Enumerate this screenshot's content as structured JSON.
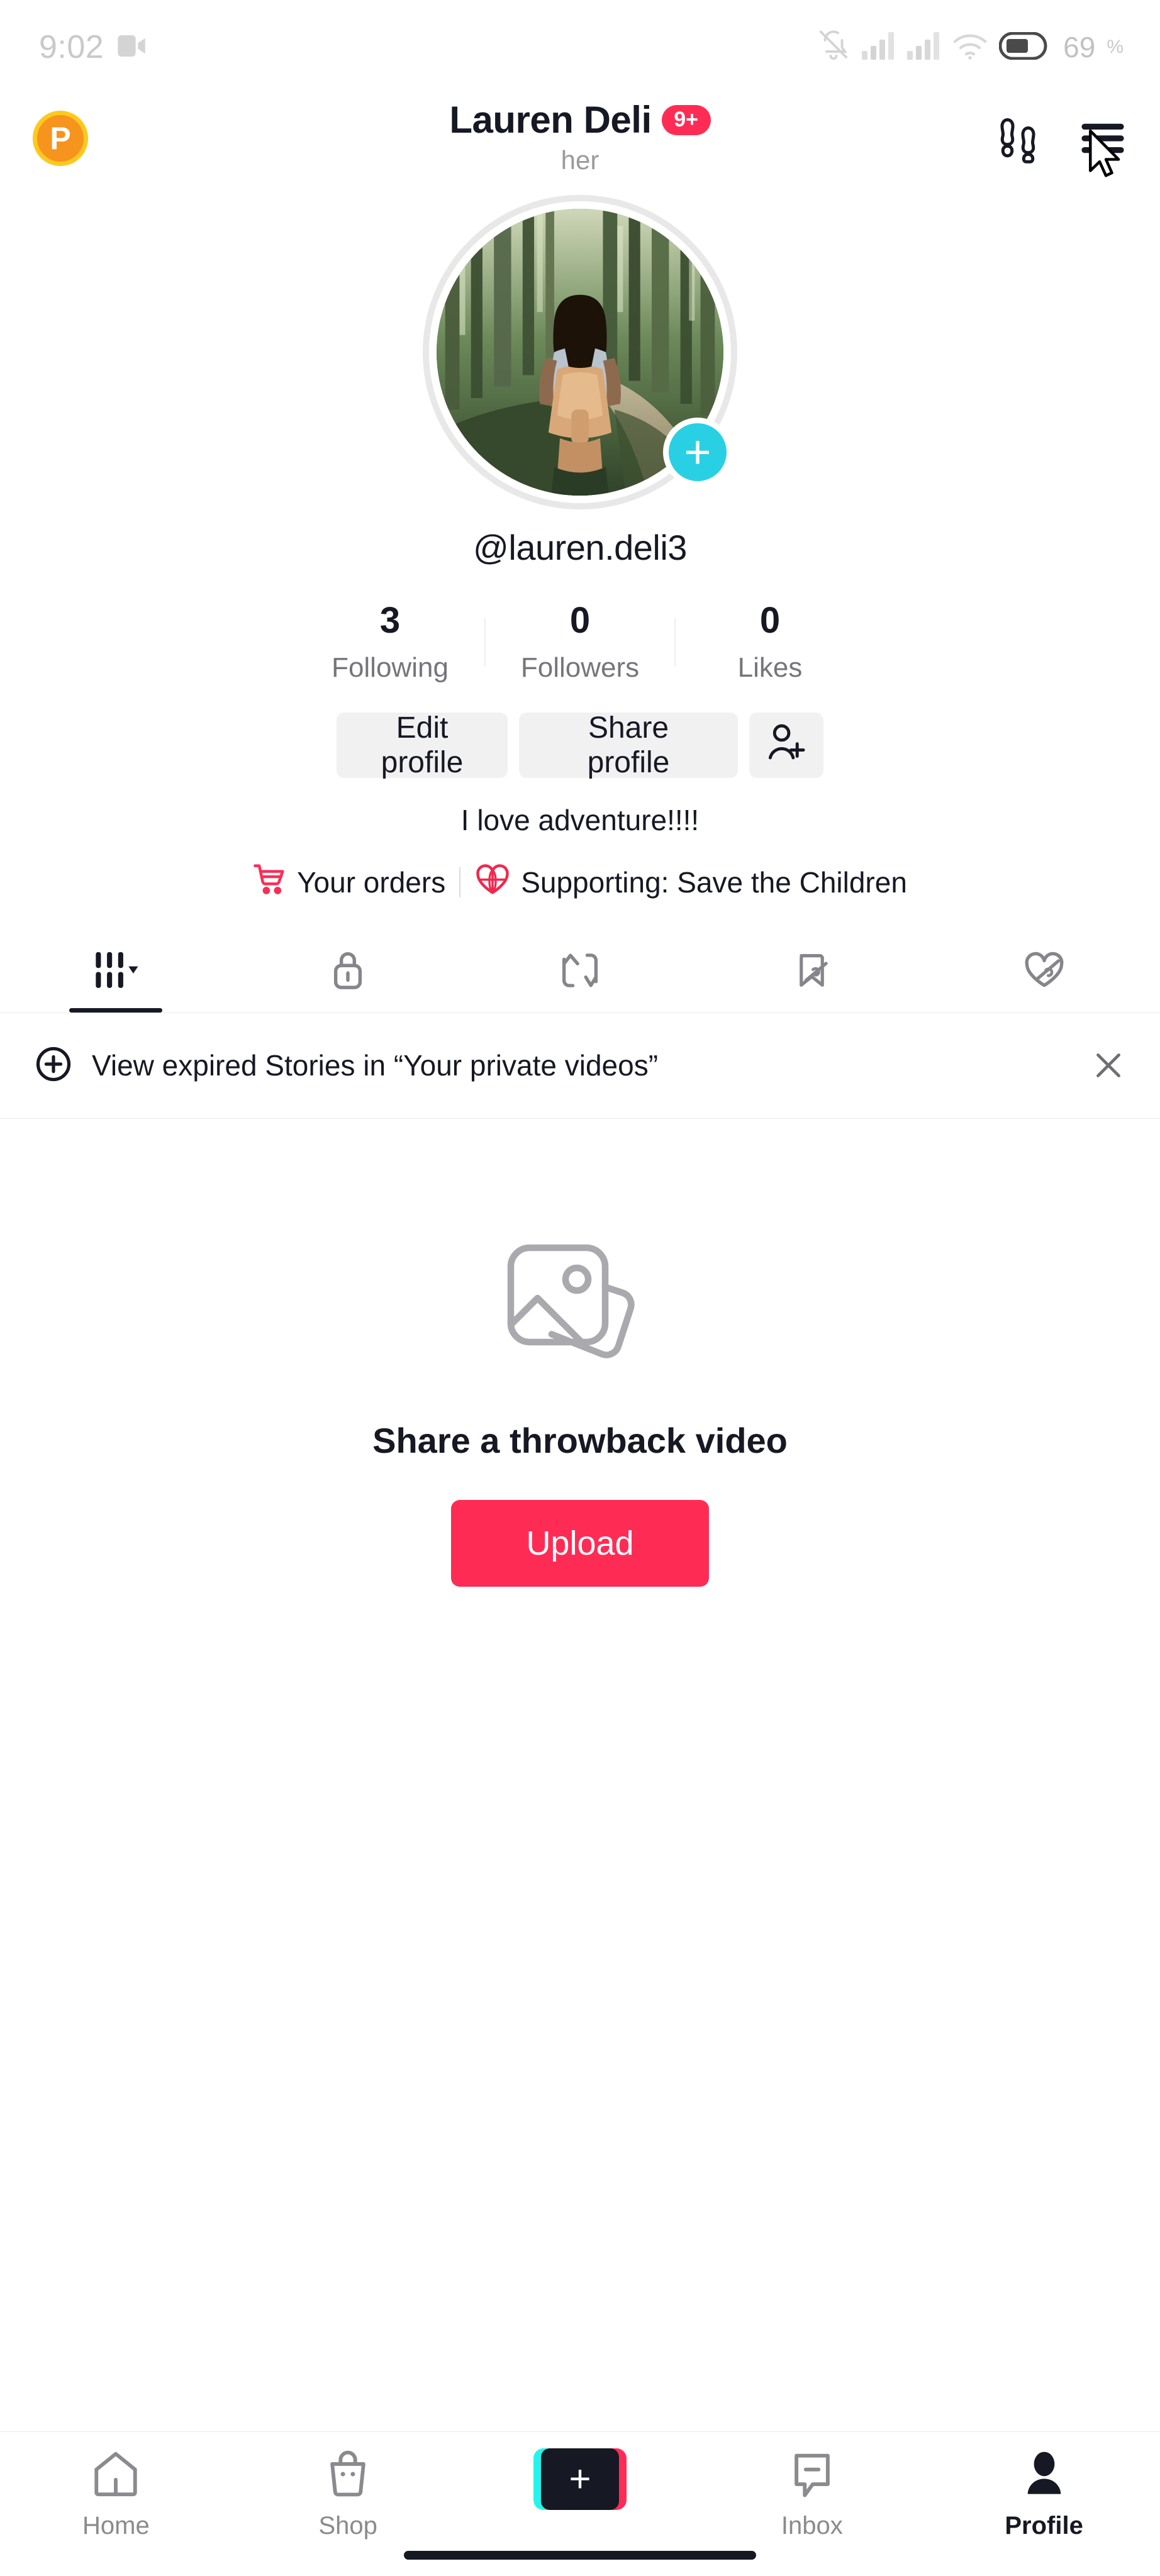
{
  "status_bar": {
    "time": "9:02",
    "screen_record_icon": "video-camera-icon",
    "mute_icon": "bell-muted-icon",
    "signal1_icon": "cellular-signal-icon",
    "signal2_icon": "cellular-signal-icon",
    "wifi_icon": "wifi-icon",
    "battery_percent": "69",
    "battery_percent_symbol": "%"
  },
  "header": {
    "profile_badge_letter": "P",
    "display_name": "Lauren Deli",
    "notification_badge": "9+",
    "pronouns": "her",
    "footprints_icon": "footprints-icon",
    "menu_icon": "hamburger-menu-icon"
  },
  "profile": {
    "avatar_alt": "woman-with-backpack-hiking-in-forest",
    "add_story_label": "+",
    "username": "@lauren.deli3"
  },
  "stats": [
    {
      "value": "3",
      "label": "Following"
    },
    {
      "value": "0",
      "label": "Followers"
    },
    {
      "value": "0",
      "label": "Likes"
    }
  ],
  "actions": {
    "edit_profile": "Edit profile",
    "share_profile": "Share profile",
    "add_friends_icon": "add-person-icon"
  },
  "bio": {
    "text": "I love adventure!!!!",
    "orders_label": "Your orders",
    "orders_icon": "shopping-cart-icon",
    "supporting_label": "Supporting: Save the Children",
    "supporting_icon": "heart-globe-icon"
  },
  "tabs": [
    {
      "name": "posts",
      "icon": "grid-bars-icon",
      "active": true,
      "has_caret": true
    },
    {
      "name": "private",
      "icon": "lock-icon",
      "active": false
    },
    {
      "name": "reposts",
      "icon": "repost-arrows-icon",
      "active": false
    },
    {
      "name": "favorites",
      "icon": "bookmark-slash-icon",
      "active": false
    },
    {
      "name": "liked",
      "icon": "heart-slash-icon",
      "active": false
    }
  ],
  "banner": {
    "icon": "circle-plus-icon",
    "text": "View expired Stories in “Your private videos”",
    "close_icon": "close-icon"
  },
  "empty_state": {
    "icon": "stacked-photos-icon",
    "title": "Share a throwback video",
    "upload_label": "Upload"
  },
  "bottom_nav": [
    {
      "label": "Home",
      "icon": "home-icon",
      "active": false
    },
    {
      "label": "Shop",
      "icon": "shopping-bag-icon",
      "active": false
    },
    {
      "label": "",
      "icon": "create-plus-icon",
      "active": false
    },
    {
      "label": "Inbox",
      "icon": "message-icon",
      "active": false
    },
    {
      "label": "Profile",
      "icon": "person-icon",
      "active": true
    }
  ],
  "colors": {
    "accent_red": "#FE2C55",
    "accent_cyan": "#25F4EE",
    "story_plus_cyan": "#29D0E4",
    "badge_orange": "#F7941D",
    "gray_button": "#F1F1F2",
    "text_primary": "#161823",
    "text_secondary": "#75757b"
  }
}
